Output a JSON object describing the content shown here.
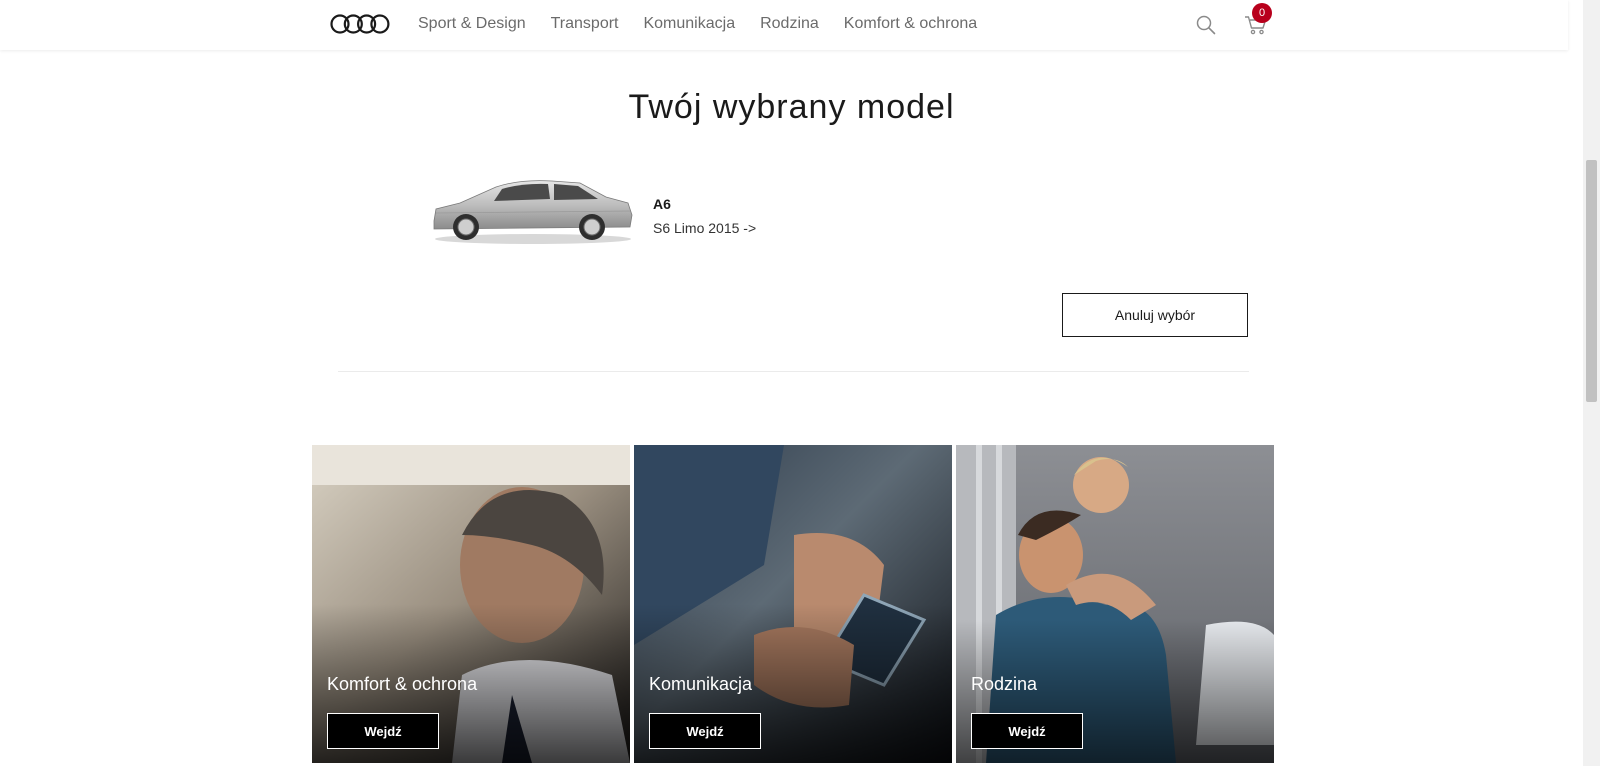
{
  "header": {
    "logo": "audi-rings-logo",
    "nav": [
      {
        "label": "Sport & Design"
      },
      {
        "label": "Transport"
      },
      {
        "label": "Komunikacja"
      },
      {
        "label": "Rodzina"
      },
      {
        "label": "Komfort & ochrona"
      }
    ],
    "cart_count": "0"
  },
  "selected_model": {
    "title": "Twój wybrany model",
    "model_name": "A6",
    "model_variant": "S6 Limo 2015 ->",
    "cancel_label": "Anuluj wybór"
  },
  "tiles": [
    {
      "title": "Komfort & ochrona",
      "button": "Wejdź"
    },
    {
      "title": "Komunikacja",
      "button": "Wejdź"
    },
    {
      "title": "Rodzina",
      "button": "Wejdź"
    }
  ],
  "colors": {
    "accent": "#b8001c",
    "text": "#1a1a1a",
    "nav_text": "#6b6b6b"
  }
}
